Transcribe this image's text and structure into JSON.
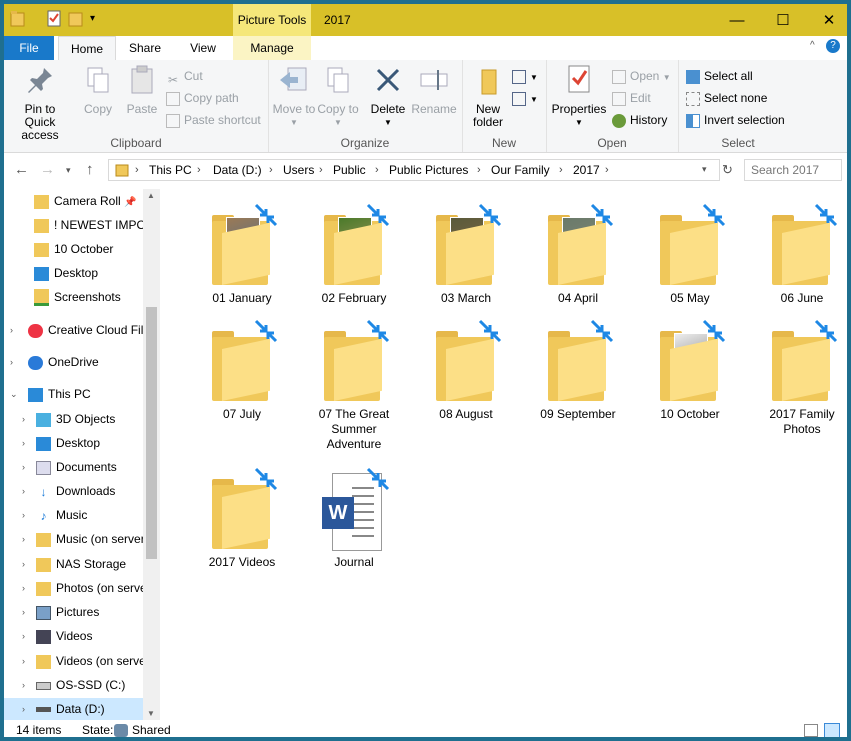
{
  "titlebar": {
    "context_tab": "Picture Tools",
    "title": "2017",
    "minimize": "—",
    "maximize": "☐",
    "close": "✕"
  },
  "tabs": {
    "file": "File",
    "home": "Home",
    "share": "Share",
    "view": "View",
    "manage": "Manage"
  },
  "ribbon": {
    "clipboard": {
      "label": "Clipboard",
      "pin": "Pin to Quick access",
      "copy": "Copy",
      "paste": "Paste",
      "cut": "Cut",
      "copy_path": "Copy path",
      "paste_shortcut": "Paste shortcut"
    },
    "organize": {
      "label": "Organize",
      "move_to": "Move to",
      "copy_to": "Copy to",
      "delete": "Delete",
      "rename": "Rename"
    },
    "new": {
      "label": "New",
      "new_folder": "New folder"
    },
    "open": {
      "label": "Open",
      "properties": "Properties",
      "open": "Open",
      "edit": "Edit",
      "history": "History"
    },
    "select": {
      "label": "Select",
      "select_all": "Select all",
      "select_none": "Select none",
      "invert": "Invert selection"
    }
  },
  "address": {
    "crumbs": [
      "This PC",
      "Data (D:)",
      "Users",
      "Public",
      "Public Pictures",
      "Our Family",
      "2017"
    ],
    "search_placeholder": "Search 2017"
  },
  "nav": {
    "quick": [
      "Camera Roll",
      "! NEWEST IMPOI",
      "10 October",
      "Desktop",
      "Screenshots"
    ],
    "creative_cloud": "Creative Cloud Fil",
    "onedrive": "OneDrive",
    "this_pc": "This PC",
    "pc_items": [
      "3D Objects",
      "Desktop",
      "Documents",
      "Downloads",
      "Music",
      "Music (on server",
      "NAS Storage",
      "Photos (on serve",
      "Pictures",
      "Videos",
      "Videos (on serve",
      "OS-SSD (C:)",
      "Data (D:)"
    ]
  },
  "items": [
    {
      "name": "01 January",
      "type": "photo-folder"
    },
    {
      "name": "02 February",
      "type": "photo-folder"
    },
    {
      "name": "03 March",
      "type": "photo-folder"
    },
    {
      "name": "04 April",
      "type": "photo-folder"
    },
    {
      "name": "05 May",
      "type": "folder"
    },
    {
      "name": "06 June",
      "type": "folder"
    },
    {
      "name": "07 July",
      "type": "folder"
    },
    {
      "name": "07 The Great Summer Adventure",
      "type": "folder"
    },
    {
      "name": "08 August",
      "type": "folder"
    },
    {
      "name": "09 September",
      "type": "folder"
    },
    {
      "name": "10 October",
      "type": "photo-folder"
    },
    {
      "name": "2017 Family Photos",
      "type": "folder"
    },
    {
      "name": "2017 Videos",
      "type": "folder"
    },
    {
      "name": "Journal",
      "type": "word-doc"
    }
  ],
  "status": {
    "count": "14 items",
    "state_label": "State:",
    "state_value": "Shared"
  },
  "colors": {
    "titlebar": "#d8c028",
    "file_tab": "#1979ca",
    "folder": "#f0c85a",
    "sync_arrow": "#1e88e5"
  }
}
